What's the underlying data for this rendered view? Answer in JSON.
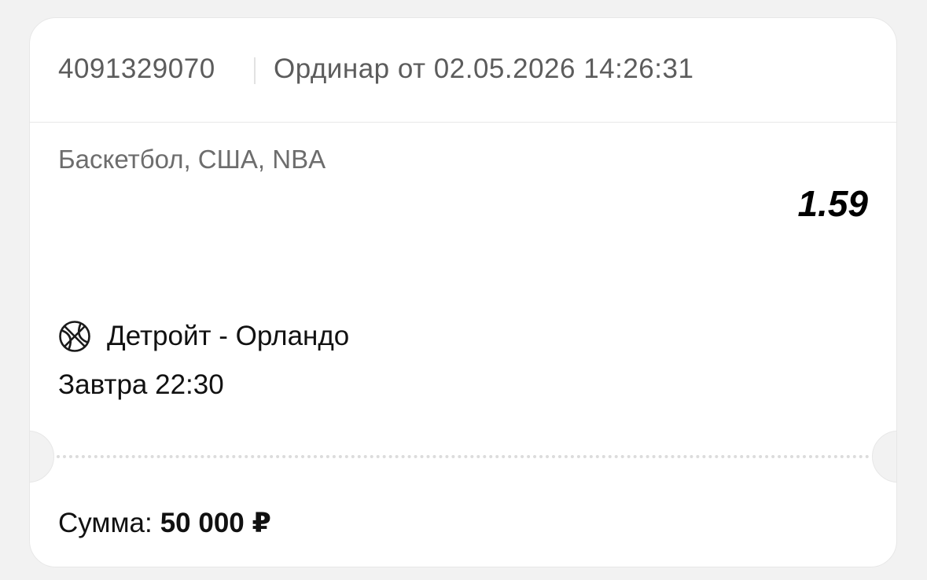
{
  "ticket": {
    "id": "4091329070",
    "bet_type": "Ординар от 02.05.2026 14:26:31",
    "sport_path": "Баскетбол, США, NBA",
    "odds": "1.59",
    "match_icon": "basketball-icon",
    "match_name": "Детройт - Орландо",
    "match_time": "Завтра 22:30",
    "sum_label": "Сумма:",
    "sum_value": "50 000 ₽"
  },
  "colors": {
    "background": "#f2f2f2",
    "card": "#ffffff",
    "muted_text": "#5c5c5c",
    "primary_text": "#111111"
  }
}
